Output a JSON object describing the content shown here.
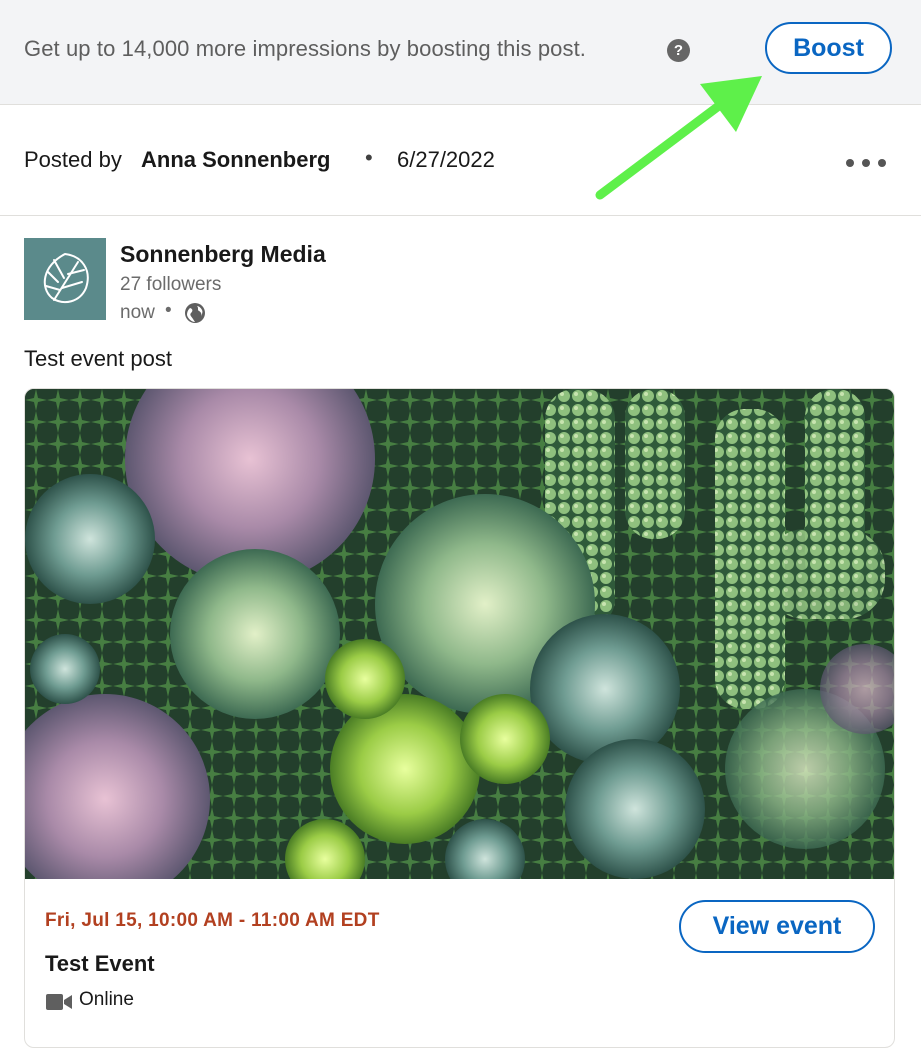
{
  "boost_banner": {
    "text": "Get up to 14,000 more impressions by boosting this post.",
    "help_icon": "question-circle-icon",
    "help_glyph": "?",
    "boost_label": "Boost",
    "annotation_arrow_color": "#5ef04a"
  },
  "post_meta": {
    "posted_by_prefix": "Posted by",
    "author": "Anna Sonnenberg",
    "separator": "•",
    "date": "6/27/2022",
    "more_icon": "more-horizontal-icon"
  },
  "post": {
    "company_name": "Sonnenberg Media",
    "followers": "27 followers",
    "time": "now",
    "time_separator": "•",
    "visibility_icon": "globe-icon",
    "logo_icon": "leaf-logo-icon",
    "text": "Test event post"
  },
  "event": {
    "image_description_icon": "succulent-photo",
    "date_time": "Fri, Jul 15, 10:00 AM - 11:00 AM EDT",
    "title": "Test Event",
    "format_icon": "video-camera-icon",
    "format": "Online",
    "view_label": "View event"
  },
  "colors": {
    "brand_blue": "#0a66c2",
    "event_date": "#b24020",
    "logo_bg": "#5b8a8b",
    "banner_bg": "#f3f4f6"
  }
}
